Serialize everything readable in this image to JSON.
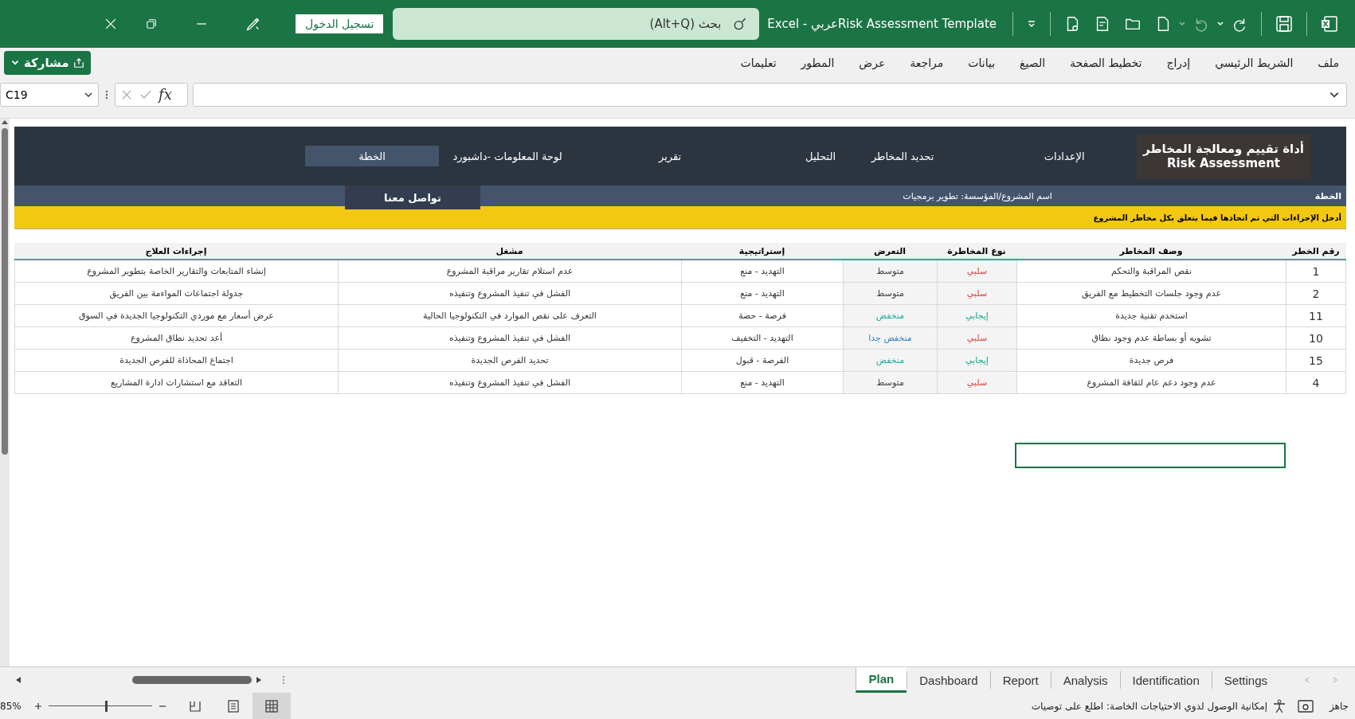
{
  "title_bar": {
    "title": "Excel - عربيRisk Assessment Template",
    "search": {
      "placeholder": "بحث (Alt+Q)"
    },
    "sign_in": "تسجيل الدخول"
  },
  "ribbon_tabs": [
    "ملف",
    "الشريط الرئيسي",
    "إدراج",
    "تخطيط الصفحة",
    "الصيغ",
    "بيانات",
    "مراجعة",
    "عرض",
    "المطور",
    "تعليمات"
  ],
  "share_button": "مشاركة",
  "formula_bar": {
    "name_box": "C19",
    "function_label": "fx"
  },
  "sheet": {
    "logo": {
      "title": "أداة تقييم ومعالجة المخاطر",
      "subtitle": "Risk Assessment"
    },
    "nav": [
      {
        "label": "الإعدادات",
        "selected": false
      },
      {
        "label": "تحديد المخاطر",
        "selected": false
      },
      {
        "label": "التحليل",
        "selected": false
      },
      {
        "label": "تقرير",
        "selected": false
      },
      {
        "label": "لوحة المعلومات -داشبورد",
        "selected": false
      },
      {
        "label": "الخطة",
        "selected": true
      }
    ],
    "page_label": "الخطة",
    "project_label": "اسم المشروع/المؤسسة:",
    "project_name": "تطوير برمجيات",
    "contact_button": "تواصل معنا",
    "instructions": "أدخل الإجراءات التي تم اتخاذها فيما يتعلق بكل مخاطر المشروع",
    "table": {
      "columns": [
        "رقم الخطر",
        "وصف المخاطر",
        "نوع المخاطرة",
        "التعرض",
        "إستراتيجية",
        "مشغل",
        "إجراءات العلاج"
      ],
      "rows": [
        {
          "number": "1",
          "description": "نقص المراقبة والتحكم",
          "type": {
            "text": "سلبي",
            "color": "#e0403c"
          },
          "exposure": {
            "text": "متوسط",
            "color": "#404040"
          },
          "strategy": "التهديد - منع",
          "trigger": "عدم استلام تقارير مراقبة المشروع",
          "actions": "إنشاء المتابعات والتقارير الخاصة بتطوير المشروع"
        },
        {
          "number": "2",
          "description": "عدم وجود جلسات التخطيط مع الفريق",
          "type": {
            "text": "سلبي",
            "color": "#e0403c"
          },
          "exposure": {
            "text": "متوسط",
            "color": "#404040"
          },
          "strategy": "التهديد - منع",
          "trigger": "الفشل في تنفيذ المشروع وتنفيذه",
          "actions": "جدولة اجتماعات المواءمة بين الفريق"
        },
        {
          "number": "11",
          "description": "استخدم تقنية جديدة",
          "type": {
            "text": "إيجابي",
            "color": "#17a589"
          },
          "exposure": {
            "text": "منخفض",
            "color": "#1fae9c"
          },
          "strategy": "فرصة - حصة",
          "trigger": "التعرف على نقص الموارد في التكنولوجيا الحالية",
          "actions": "عرض أسعار مع موردي التكنولوجيا الجديدة في السوق"
        },
        {
          "number": "10",
          "description": "تشويه أو بساطة عدم وجود نطاق",
          "type": {
            "text": "سلبي",
            "color": "#e0403c"
          },
          "exposure": {
            "text": "منخفض جدا",
            "color": "#3585c0"
          },
          "strategy": "التهديد - التخفيف",
          "trigger": "الفشل في تنفيذ المشروع وتنفيذه",
          "actions": "أعد تحديد نطاق المشروع"
        },
        {
          "number": "15",
          "description": "فرص جديدة",
          "type": {
            "text": "إيجابي",
            "color": "#17a589"
          },
          "exposure": {
            "text": "منخفض",
            "color": "#1fae9c"
          },
          "strategy": "الفرصة - قبول",
          "trigger": "تحديد الفرص الجديدة",
          "actions": "اجتماع المحاذاة للفرص الجديدة"
        },
        {
          "number": "4",
          "description": "عدم وجود دعم عام لثقافة المشروع",
          "type": {
            "text": "سلبي",
            "color": "#e0403c"
          },
          "exposure": {
            "text": "متوسط",
            "color": "#404040"
          },
          "strategy": "التهديد - منع",
          "trigger": "الفشل في تنفيذ المشروع وتنفيذه",
          "actions": "التعاقد مع استشارات ادارة المشاريع"
        }
      ]
    }
  },
  "sheet_tabs": [
    {
      "label": "Settings",
      "selected": false
    },
    {
      "label": "Identification",
      "selected": false
    },
    {
      "label": "Analysis",
      "selected": false
    },
    {
      "label": "Report",
      "selected": false
    },
    {
      "label": "Dashboard",
      "selected": false
    },
    {
      "label": "Plan",
      "selected": true
    }
  ],
  "status_bar": {
    "ready": "جاهز",
    "accessibility": "إمكانية الوصول لذوي الاحتياجات الخاصة: اطلع على توصيات",
    "zoom": "85%",
    "zoom_slider": {
      "level": 0.56
    }
  }
}
